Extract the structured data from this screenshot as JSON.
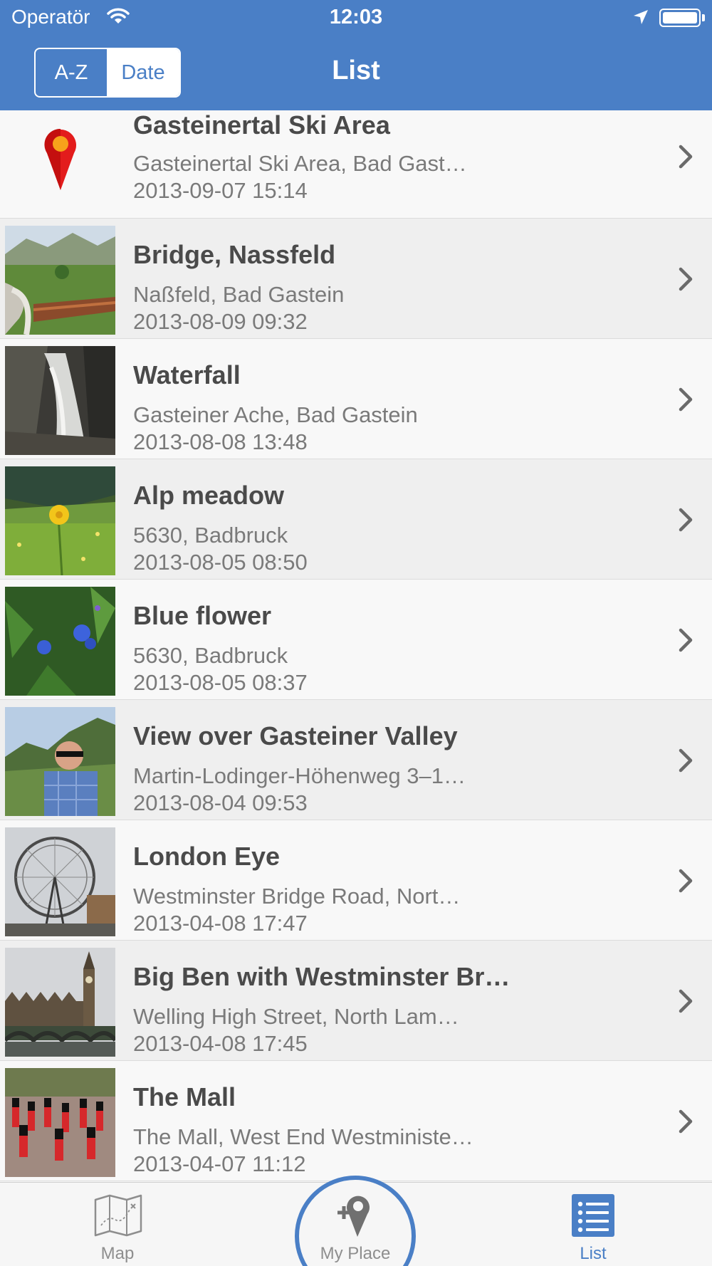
{
  "status_bar": {
    "carrier": "Operatör",
    "time": "12:03"
  },
  "nav": {
    "title": "List",
    "segments": [
      "A-Z",
      "Date"
    ],
    "selected_segment": "Date"
  },
  "items": [
    {
      "title": "Gasteinertal Ski Area",
      "subtitle": "Gasteinertal Ski Area, Bad Gast…",
      "date": "2013-09-07 15:14",
      "thumb": "map-pin"
    },
    {
      "title": "Bridge, Nassfeld",
      "subtitle": "Naßfeld, Bad Gastein",
      "date": "2013-08-09 09:32",
      "thumb": "photo-bridge"
    },
    {
      "title": "Waterfall",
      "subtitle": "Gasteiner Ache, Bad Gastein",
      "date": "2013-08-08 13:48",
      "thumb": "photo-waterfall"
    },
    {
      "title": "Alp meadow",
      "subtitle": "5630, Badbruck",
      "date": "2013-08-05 08:50",
      "thumb": "photo-meadow"
    },
    {
      "title": "Blue flower",
      "subtitle": "5630, Badbruck",
      "date": "2013-08-05 08:37",
      "thumb": "photo-flower"
    },
    {
      "title": "View over Gasteiner Valley",
      "subtitle": "Martin-Lodinger-Höhenweg 3–1…",
      "date": "2013-08-04 09:53",
      "thumb": "photo-valley"
    },
    {
      "title": "London Eye",
      "subtitle": "Westminster Bridge Road, Nort…",
      "date": "2013-04-08 17:47",
      "thumb": "photo-london-eye"
    },
    {
      "title": "Big Ben with Westminster Br…",
      "subtitle": "Welling High Street, North Lam…",
      "date": "2013-04-08 17:45",
      "thumb": "photo-big-ben"
    },
    {
      "title": "The Mall",
      "subtitle": "The Mall, West End Westministe…",
      "date": "2013-04-07 11:12",
      "thumb": "photo-the-mall"
    }
  ],
  "tabbar": {
    "tabs": [
      {
        "label": "Map",
        "icon": "map-icon"
      },
      {
        "label": "My Place",
        "icon": "add-place-icon"
      },
      {
        "label": "List",
        "icon": "list-icon",
        "selected": true
      }
    ]
  },
  "colors": {
    "accent": "#4a7fc6",
    "title_text": "#4a4a4a",
    "secondary_text": "#7a7a7a"
  }
}
